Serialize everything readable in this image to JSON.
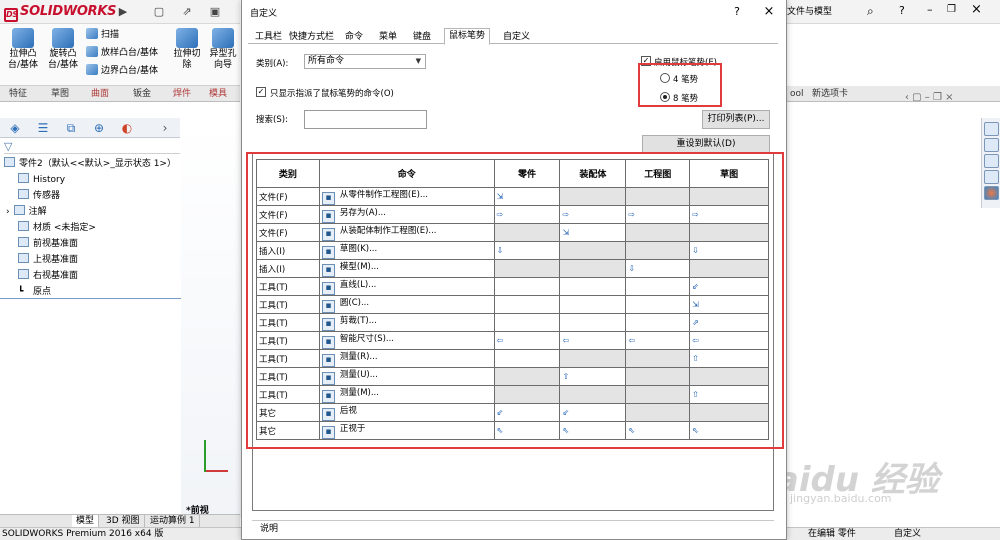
{
  "app": {
    "logo": "SOLIDWORKS",
    "ribbon": {
      "extrude": "拉伸凸台/基体",
      "revolve": "旋转凸台/基体",
      "sweep": "扫描",
      "loft": "放样凸台/基体",
      "boundary": "边界凸台/基体",
      "extrude_cut": "拉伸切除",
      "hole_wizard": "异型孔向导"
    },
    "command_tabs": [
      "特征",
      "草图",
      "曲面",
      "钣金",
      "焊件",
      "模具工"
    ],
    "right_tabs": [
      "ool",
      "新选项卡"
    ],
    "search_placeholder": "文件与模型",
    "tree": {
      "root": "零件2（默认<<默认>_显示状态 1>）",
      "items": [
        "History",
        "传感器",
        "注解",
        "材质 <未指定>",
        "前视基准面",
        "上视基准面",
        "右视基准面",
        "原点"
      ]
    },
    "bottom_tabs": [
      "模型",
      "3D 视图",
      "运动算例 1"
    ],
    "view_label": "*前视",
    "status_left": "SOLIDWORKS Premium 2016 x64 版",
    "status_mid": "在编辑 零件",
    "status_right": "自定义",
    "watermark": "Baidu 经验",
    "watermark_url": "jingyan.baidu.com"
  },
  "dialog": {
    "title": "自定义",
    "help": "?",
    "close": "×",
    "tabs": [
      "工具栏",
      "快捷方式栏",
      "命令",
      "菜单",
      "键盘",
      "鼠标笔势",
      "自定义"
    ],
    "active_tab": "鼠标笔势",
    "category_label": "类别(A):",
    "category_value": "所有命令",
    "only_assigned_label": "只显示指派了鼠标笔势的命令(O)",
    "only_assigned_checked": true,
    "enable_label": "启用鼠标笔势(E)",
    "enable_checked": true,
    "radio4": "4 笔势",
    "radio8": "8 笔势",
    "radio_selected": "8",
    "search_label": "搜索(S):",
    "search_value": "",
    "print_button": "打印列表(P)...",
    "reset_button": "重设到默认(D)",
    "description_label": "说明",
    "columns": [
      "类别",
      "命令",
      "零件",
      "装配体",
      "工程图",
      "草图"
    ],
    "rows": [
      {
        "cat": "文件(F)",
        "icon": "file-from-part-icon",
        "cmd": "从零件制作工程图(E)...",
        "part": "⇲",
        "asm": "",
        "drw": "",
        "sk": ""
      },
      {
        "cat": "文件(F)",
        "icon": "save-as-icon",
        "cmd": "另存为(A)...",
        "part": "⇨",
        "asm": "⇨",
        "drw": "⇨",
        "sk": "⇨"
      },
      {
        "cat": "文件(F)",
        "icon": "file-from-assembly-icon",
        "cmd": "从装配体制作工程图(E)...",
        "part": "",
        "asm": "⇲",
        "drw": "",
        "sk": ""
      },
      {
        "cat": "插入(I)",
        "icon": "sketch-icon",
        "cmd": "草图(K)...",
        "part": "⇩",
        "asm": "",
        "drw": "",
        "sk": "⇩"
      },
      {
        "cat": "插入(I)",
        "icon": "model-icon",
        "cmd": "模型(M)...",
        "part": "",
        "asm": "",
        "drw": "⇩",
        "sk": ""
      },
      {
        "cat": "工具(T)",
        "icon": "line-icon",
        "cmd": "直线(L)...",
        "part": "",
        "asm": "",
        "drw": "",
        "sk": "⇙"
      },
      {
        "cat": "工具(T)",
        "icon": "circle-icon",
        "cmd": "圆(C)...",
        "part": "",
        "asm": "",
        "drw": "",
        "sk": "⇲"
      },
      {
        "cat": "工具(T)",
        "icon": "trim-icon",
        "cmd": "剪裁(T)...",
        "part": "",
        "asm": "",
        "drw": "",
        "sk": "⇗"
      },
      {
        "cat": "工具(T)",
        "icon": "smart-dimension-icon",
        "cmd": "智能尺寸(S)...",
        "part": "⇦",
        "asm": "⇦",
        "drw": "⇦",
        "sk": "⇦"
      },
      {
        "cat": "工具(T)",
        "icon": "measure-icon",
        "cmd": "测量(R)...",
        "part": "",
        "asm": "",
        "drw": "",
        "sk": "⇧"
      },
      {
        "cat": "工具(T)",
        "icon": "measure-icon",
        "cmd": "测量(U)...",
        "part": "",
        "asm": "⇧",
        "drw": "",
        "sk": ""
      },
      {
        "cat": "工具(T)",
        "icon": "measure-icon",
        "cmd": "测量(M)...",
        "part": "",
        "asm": "",
        "drw": "",
        "sk": "⇧"
      },
      {
        "cat": "其它",
        "icon": "back-view-icon",
        "cmd": "后视",
        "part": "⇙",
        "asm": "⇙",
        "drw": "",
        "sk": ""
      },
      {
        "cat": "其它",
        "icon": "front-view-icon",
        "cmd": "正视于",
        "part": "⇖",
        "asm": "⇖",
        "drw": "⇖",
        "sk": "⇖"
      }
    ]
  }
}
